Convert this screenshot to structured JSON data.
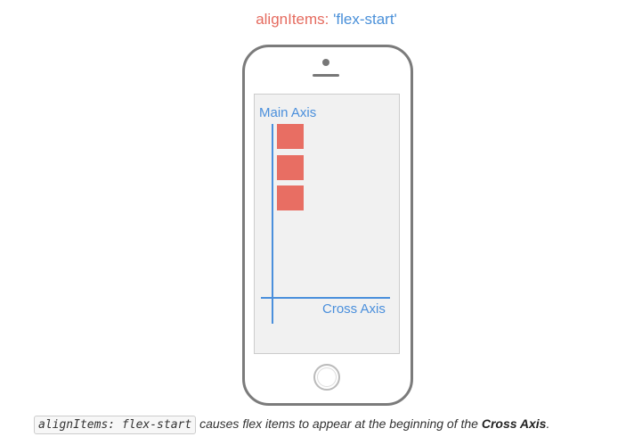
{
  "title": {
    "key": "alignItems:",
    "value": "'flex-start'"
  },
  "diagram": {
    "main_axis_label": "Main Axis",
    "cross_axis_label": "Cross Axis",
    "item_count": 3,
    "item_color": "#e86e63",
    "axis_color": "#4a8fdc"
  },
  "caption": {
    "code": "alignItems: flex-start",
    "text": "causes flex items to appear at the beginning of the",
    "emphasis": "Cross Axis",
    "end": "."
  }
}
